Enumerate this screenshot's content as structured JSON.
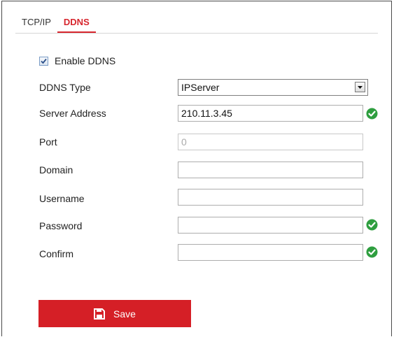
{
  "tabs": [
    {
      "label": "TCP/IP",
      "active": false
    },
    {
      "label": "DDNS",
      "active": true
    }
  ],
  "enable_ddns": {
    "label": "Enable DDNS",
    "checked": true
  },
  "form": {
    "ddns_type": {
      "label": "DDNS Type",
      "value": "IPServer"
    },
    "server_address": {
      "label": "Server Address",
      "value": "210.11.3.45",
      "valid": true
    },
    "port": {
      "label": "Port",
      "value": "0",
      "disabled": true
    },
    "domain": {
      "label": "Domain",
      "value": ""
    },
    "username": {
      "label": "Username",
      "value": ""
    },
    "password": {
      "label": "Password",
      "value": "",
      "valid": true
    },
    "confirm": {
      "label": "Confirm",
      "value": "",
      "valid": true
    }
  },
  "save_button": {
    "label": "Save",
    "icon": "floppy-disk-icon"
  },
  "colors": {
    "accent": "#d51f26",
    "valid": "#2e9e3f"
  }
}
